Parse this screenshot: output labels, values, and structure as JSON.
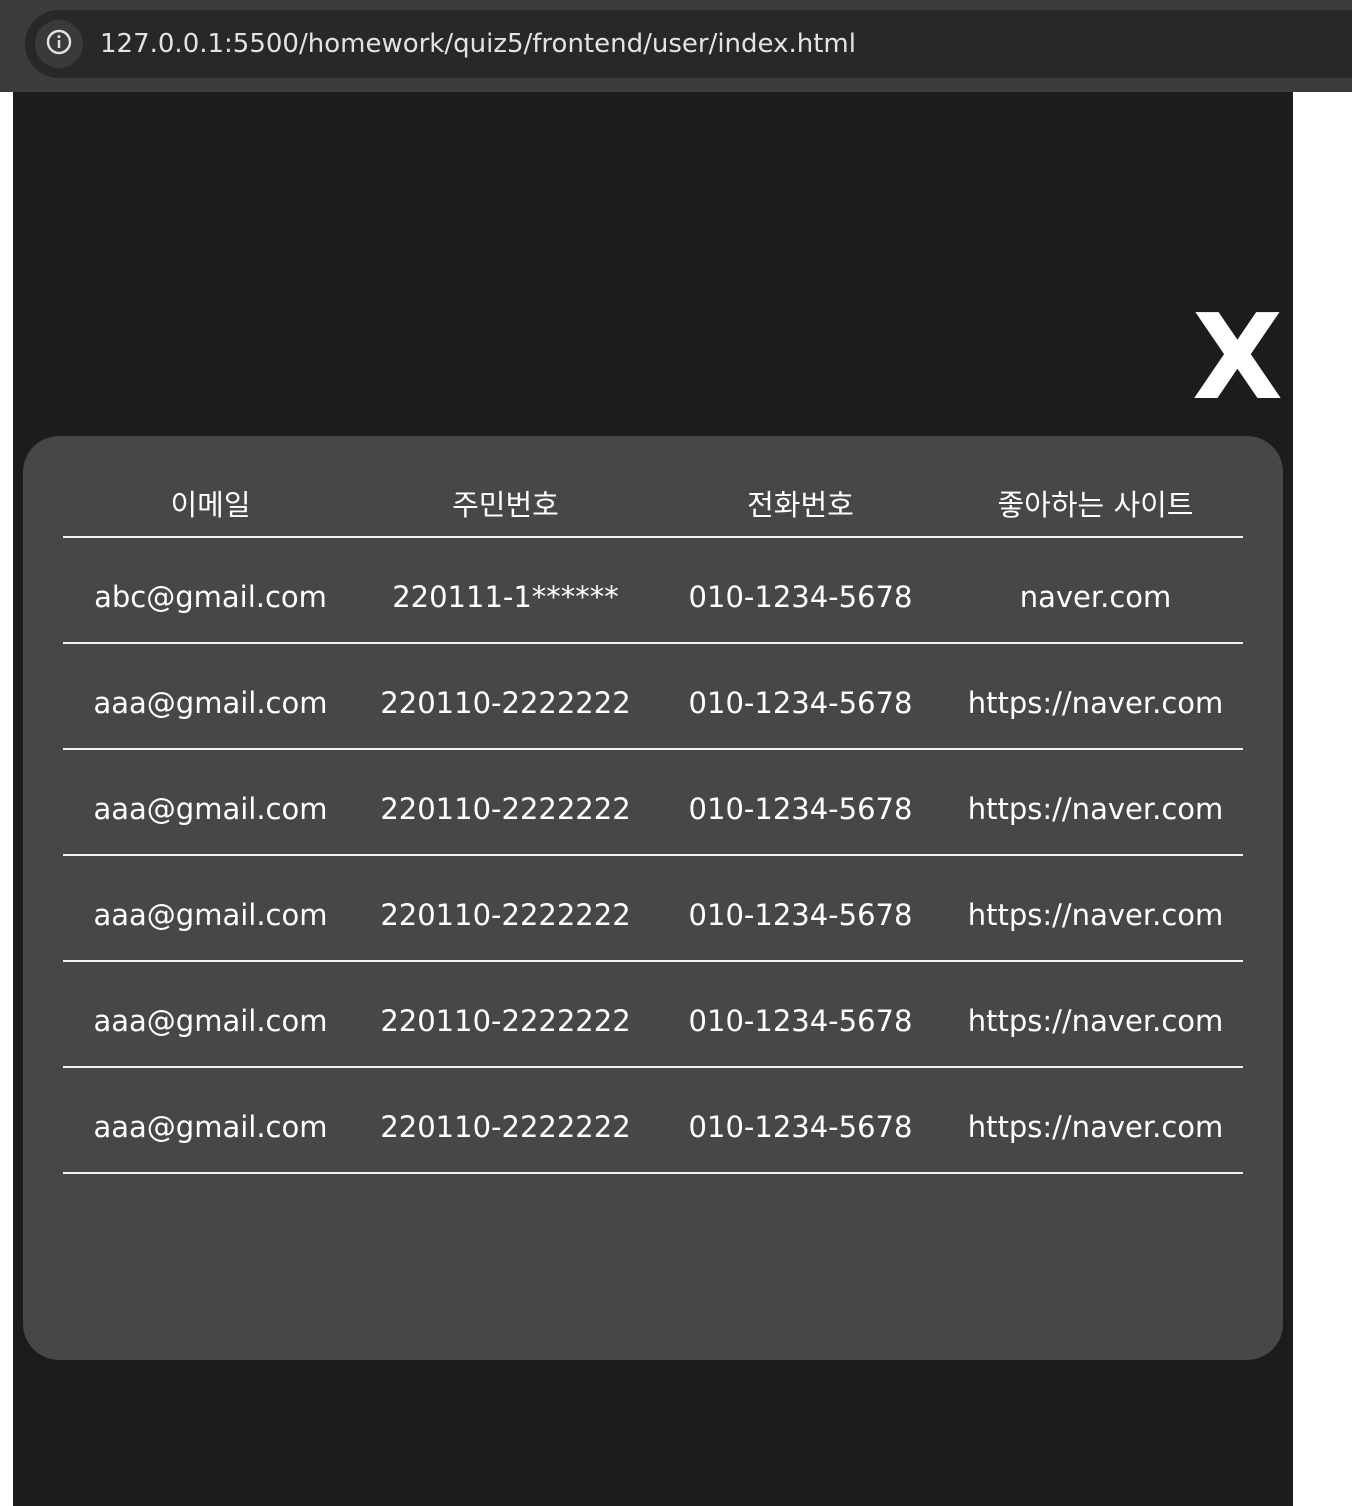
{
  "browser": {
    "url": "127.0.0.1:5500/homework/quiz5/frontend/user/index.html",
    "info_icon": "info-circle-icon"
  },
  "page": {
    "close_label": "X"
  },
  "table": {
    "headers": [
      "이메일",
      "주민번호",
      "전화번호",
      "좋아하는 사이트"
    ],
    "rows": [
      [
        "abc@gmail.com",
        "220111-1******",
        "010-1234-5678",
        "naver.com"
      ],
      [
        "aaa@gmail.com",
        "220110-2222222",
        "010-1234-5678",
        "https://naver.com"
      ],
      [
        "aaa@gmail.com",
        "220110-2222222",
        "010-1234-5678",
        "https://naver.com"
      ],
      [
        "aaa@gmail.com",
        "220110-2222222",
        "010-1234-5678",
        "https://naver.com"
      ],
      [
        "aaa@gmail.com",
        "220110-2222222",
        "010-1234-5678",
        "https://naver.com"
      ],
      [
        "aaa@gmail.com",
        "220110-2222222",
        "010-1234-5678",
        "https://naver.com"
      ]
    ]
  },
  "colors": {
    "page_background": "#1c1c1c",
    "panel_background": "#474747",
    "text": "#ffffff"
  }
}
